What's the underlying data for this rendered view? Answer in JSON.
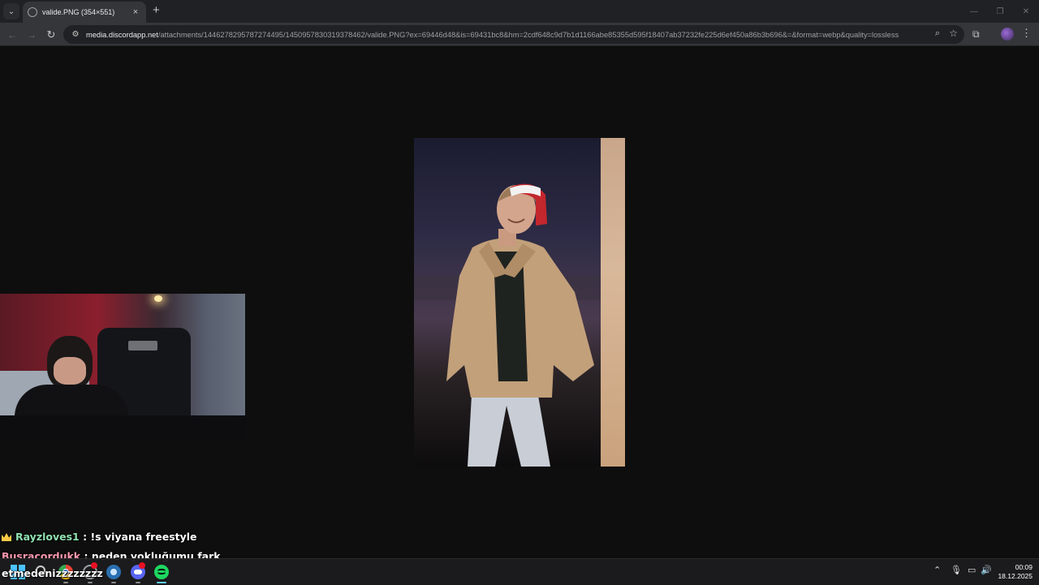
{
  "browser": {
    "tab": {
      "title": "valide.PNG (354×551)",
      "close_glyph": "×"
    },
    "tab_search_glyph": "⌄",
    "new_tab_glyph": "+",
    "window_controls": {
      "minimize": "—",
      "maximize": "❐",
      "close": "✕"
    },
    "nav": {
      "back": "←",
      "forward": "→",
      "reload": "↻"
    },
    "omnibox": {
      "url_host": "media.discordapp.net",
      "url_rest": "/attachments/1446278295787274495/1450957830319378462/valide.PNG?ex=69446d48&is=69431bc8&hm=2cdf648c9d7b1d1166abe85355d595f18407ab37232fe225d6ef450a86b3b696&=&format=webp&quality=lossless"
    },
    "icons": {
      "zoom": "⌕",
      "star": "☆",
      "extensions": "⧉",
      "menu": "⋮"
    }
  },
  "viewer": {
    "image_description_icon": "photo",
    "image_alt": "valide.PNG"
  },
  "chat": {
    "messages": [
      {
        "user": "Rayzloves1",
        "separator": " : ",
        "text": "!s viyana freestyle",
        "badge": "crown-icon",
        "color": "#8fe0b0"
      },
      {
        "user": "Busracordukk",
        "separator": " : ",
        "text": "neden yokluğumu fark",
        "color": "#ff9ab0"
      },
      {
        "continuation": "etmedenizzzzzzzz"
      }
    ]
  },
  "taskbar": {
    "apps": [
      "start-icon",
      "search-icon",
      "chrome-icon",
      "app-icon",
      "steam-icon",
      "discord-icon",
      "spotify-icon"
    ],
    "tray": {
      "chevron": "⌃",
      "mic": "🎙",
      "network": "▭",
      "volume": "🔊"
    },
    "clock": {
      "time": "00:09",
      "date": "18.12.2025"
    }
  }
}
